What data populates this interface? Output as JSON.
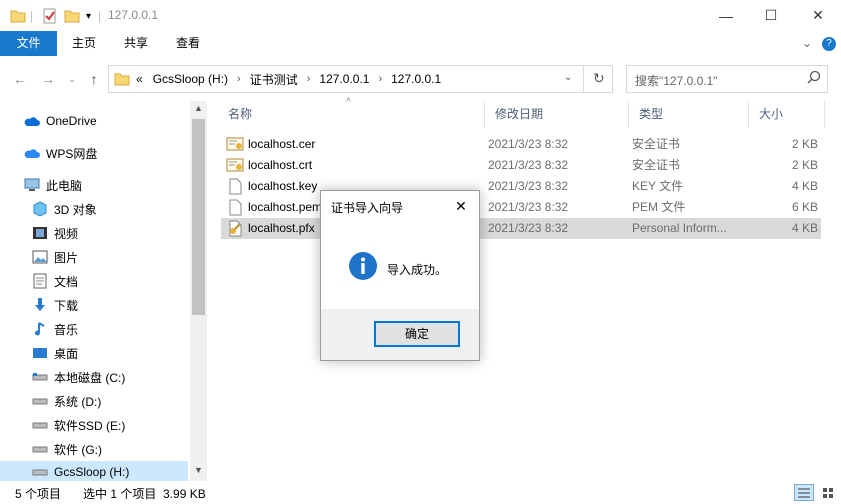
{
  "window": {
    "title": "127.0.0.1",
    "minimize": "—",
    "maximize": "☐",
    "close": "✕"
  },
  "ribbon": {
    "tabs": [
      "文件",
      "主页",
      "共享",
      "查看"
    ],
    "expand": "⌄",
    "help": "?"
  },
  "nav": {
    "breadcrumb": [
      "«",
      "GcsSloop (H:)",
      "证书测试",
      "127.0.0.1",
      "127.0.0.1"
    ],
    "search_placeholder": "搜索\"127.0.0.1\""
  },
  "sidebar": {
    "items": [
      {
        "label": "OneDrive",
        "icon": "cloud-icon"
      },
      {
        "label": "WPS网盘",
        "icon": "wps-cloud-icon"
      },
      {
        "label": "此电脑",
        "icon": "computer-icon"
      },
      {
        "label": "3D 对象",
        "icon": "cube-icon"
      },
      {
        "label": "视频",
        "icon": "video-icon"
      },
      {
        "label": "图片",
        "icon": "picture-icon"
      },
      {
        "label": "文档",
        "icon": "document-icon"
      },
      {
        "label": "下载",
        "icon": "download-icon"
      },
      {
        "label": "音乐",
        "icon": "music-icon"
      },
      {
        "label": "桌面",
        "icon": "desktop-icon"
      },
      {
        "label": "本地磁盘 (C:)",
        "icon": "drive-icon"
      },
      {
        "label": "系统 (D:)",
        "icon": "drive-icon"
      },
      {
        "label": "软件SSD (E:)",
        "icon": "drive-icon"
      },
      {
        "label": "软件 (G:)",
        "icon": "drive-icon"
      },
      {
        "label": "GcsSloop (H:)",
        "icon": "drive-icon"
      }
    ]
  },
  "columns": [
    "名称",
    "修改日期",
    "类型",
    "大小"
  ],
  "files": [
    {
      "name": "localhost.cer",
      "date": "2021/3/23 8:32",
      "type": "安全证书",
      "size": "2 KB",
      "icon": "certificate-icon"
    },
    {
      "name": "localhost.crt",
      "date": "2021/3/23 8:32",
      "type": "安全证书",
      "size": "2 KB",
      "icon": "certificate-icon"
    },
    {
      "name": "localhost.key",
      "date": "2021/3/23 8:32",
      "type": "KEY 文件",
      "size": "4 KB",
      "icon": "file-icon"
    },
    {
      "name": "localhost.pem",
      "date": "2021/3/23 8:32",
      "type": "PEM 文件",
      "size": "6 KB",
      "icon": "file-icon"
    },
    {
      "name": "localhost.pfx",
      "date": "2021/3/23 8:32",
      "type": "Personal Inform...",
      "size": "4 KB",
      "icon": "pfx-icon"
    }
  ],
  "status": {
    "count": "5 个项目",
    "selected": "选中 1 个项目  3.99 KB"
  },
  "dialog": {
    "title": "证书导入向导",
    "message": "导入成功。",
    "ok": "确定",
    "close": "✕"
  },
  "colors": {
    "accent": "#1979ca",
    "info_icon": "#1e73c8",
    "selection": "#d9d9d9"
  }
}
